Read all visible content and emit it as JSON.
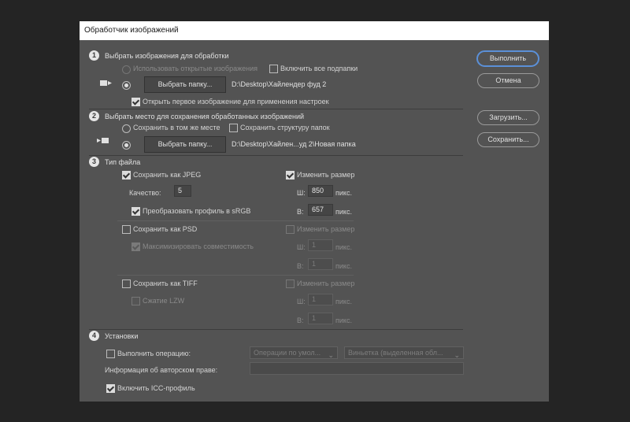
{
  "window": {
    "title": "Обработчик изображений"
  },
  "actions": {
    "run": "Выполнить",
    "cancel": "Отмена",
    "load": "Загрузить...",
    "save": "Сохранить..."
  },
  "section1": {
    "num": "1",
    "title": "Выбрать изображения для обработки",
    "use_open": "Использовать открытые изображения",
    "include_subfolders": "Включить все подпапки",
    "choose_folder": "Выбрать папку...",
    "folder_path": "D:\\Desktop\\Хайлендер фуд 2",
    "open_first": "Открыть первое изображение для применения настроек"
  },
  "section2": {
    "num": "2",
    "title": "Выбрать место для сохранения обработанных изображений",
    "same_place": "Сохранить в том же месте",
    "keep_structure": "Сохранить структуру папок",
    "choose_folder": "Выбрать папку...",
    "folder_path": "D:\\Desktop\\Хайлен...уд 2\\Новая папка"
  },
  "section3": {
    "num": "3",
    "title": "Тип файла",
    "jpeg": {
      "save_as": "Сохранить как JPEG",
      "quality_label": "Качество:",
      "quality": "5",
      "convert_profile": "Преобразовать профиль в sRGB",
      "resize": "Изменить размер",
      "w_label": "Ш:",
      "w": "850",
      "h_label": "В:",
      "h": "657",
      "unit": "пикс."
    },
    "psd": {
      "save_as": "Сохранить как PSD",
      "maximize": "Максимизировать совместимость",
      "resize": "Изменить размер",
      "w_label": "Ш:",
      "w": "1",
      "h_label": "В:",
      "h": "1",
      "unit": "пикс."
    },
    "tiff": {
      "save_as": "Сохранить как TIFF",
      "lzw": "Сжатие LZW",
      "resize": "Изменить размер",
      "w_label": "Ш:",
      "w": "1",
      "h_label": "В:",
      "h": "1",
      "unit": "пикс."
    }
  },
  "section4": {
    "num": "4",
    "title": "Установки",
    "run_action": "Выполнить операцию:",
    "action_set": "Операции по умол...",
    "action": "Виньетка (выделенная обл...",
    "copyright_label": "Информация об авторском праве:",
    "copyright": "",
    "icc": "Включить ICC-профиль"
  }
}
